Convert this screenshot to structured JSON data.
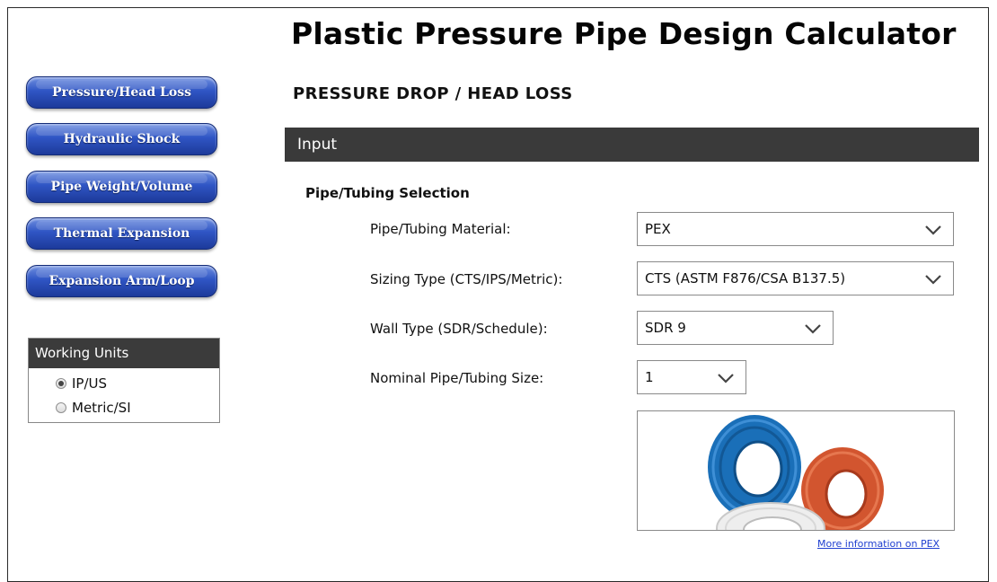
{
  "header": {
    "title": "Plastic Pressure Pipe Design Calculator",
    "section_title": "PRESSURE DROP / HEAD LOSS"
  },
  "sidebar": {
    "nav": [
      {
        "label": "Pressure/Head Loss"
      },
      {
        "label": "Hydraulic Shock"
      },
      {
        "label": "Pipe Weight/Volume"
      },
      {
        "label": "Thermal Expansion"
      },
      {
        "label": "Expansion Arm/Loop"
      }
    ],
    "units": {
      "title": "Working Units",
      "options": [
        {
          "label": "IP/US",
          "selected": true
        },
        {
          "label": "Metric/SI",
          "selected": false
        }
      ]
    }
  },
  "main": {
    "input_bar": "Input",
    "subheading": "Pipe/Tubing Selection",
    "fields": [
      {
        "label": "Pipe/Tubing Material:",
        "value": "PEX"
      },
      {
        "label": "Sizing Type (CTS/IPS/Metric):",
        "value": "CTS (ASTM F876/CSA B137.5)"
      },
      {
        "label": "Wall Type (SDR/Schedule):",
        "value": "SDR 9"
      },
      {
        "label": "Nominal Pipe/Tubing Size:",
        "value": "1"
      }
    ],
    "image": {
      "icon": "pex-tubing-coils-image"
    },
    "more_link": "More information on PEX"
  },
  "colors": {
    "nav_button": "#2f55c4",
    "dark_bar": "#3a3a3a",
    "link": "#1f3fd0",
    "coil_blue": "#1a6fb8",
    "coil_red": "#d2552f",
    "coil_white": "#eeeeee"
  }
}
